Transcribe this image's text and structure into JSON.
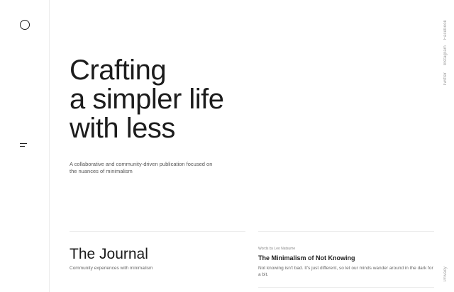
{
  "hero": {
    "title_lines": [
      "Crafting",
      "a simpler life",
      "with less"
    ],
    "subtitle": "A collaborative and community-driven publication focused on the nuances of minimalism"
  },
  "social": {
    "facebook": "Facebook",
    "instagram": "Instagram",
    "twitter": "Twitter"
  },
  "footer": {
    "privacy": "Privacy"
  },
  "journal": {
    "title": "The Journal",
    "subtitle": "Community experiences with minimalism"
  },
  "post": {
    "meta": "Words by Leo Natsume",
    "title": "The Minimalism of Not Knowing",
    "excerpt": "Not knowing isn't bad. It's just different, so let our minds wander around in the dark for a bit."
  },
  "icons": {
    "logo": "circle-logo-icon",
    "menu": "hamburger-menu-icon"
  }
}
